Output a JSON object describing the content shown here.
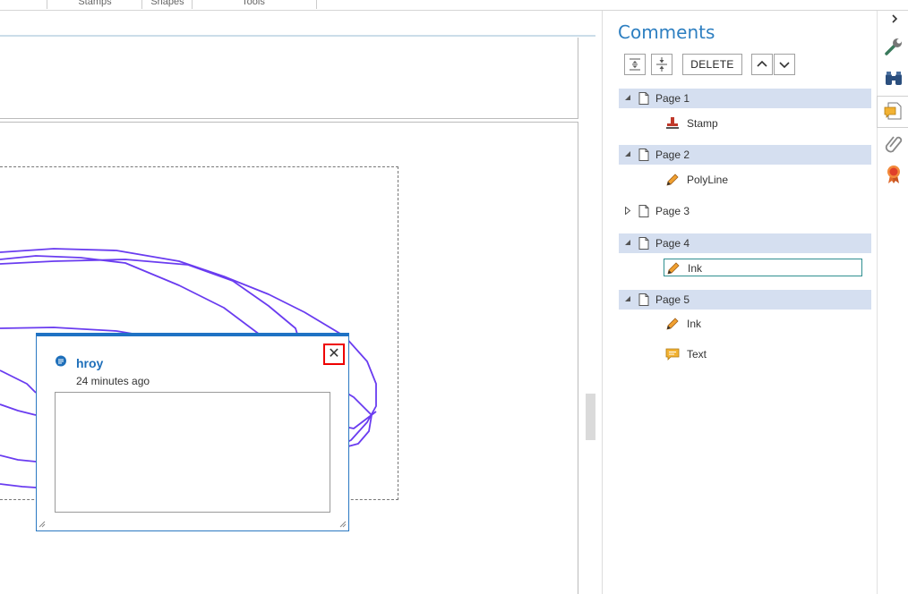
{
  "ribbon": {
    "groups": [
      "Stamps",
      "Shapes",
      "Tools"
    ]
  },
  "popup": {
    "author": "hroy",
    "time": "24 minutes ago",
    "close_glyph": "✕",
    "text": ""
  },
  "panel": {
    "title": "Comments",
    "delete_label": "DELETE",
    "pages": [
      {
        "label": "Page 1",
        "expanded": true,
        "items": [
          {
            "label": "Stamp",
            "icon": "stamp-icon"
          }
        ]
      },
      {
        "label": "Page 2",
        "expanded": true,
        "items": [
          {
            "label": "PolyLine",
            "icon": "pencil-icon"
          }
        ]
      },
      {
        "label": "Page 3",
        "expanded": false,
        "items": []
      },
      {
        "label": "Page 4",
        "expanded": true,
        "items": [
          {
            "label": "Ink",
            "icon": "pencil-icon",
            "selected": true
          }
        ]
      },
      {
        "label": "Page 5",
        "expanded": true,
        "items": [
          {
            "label": "Ink",
            "icon": "pencil-icon"
          },
          {
            "label": "Text",
            "icon": "text-note-icon"
          }
        ]
      }
    ]
  },
  "colors": {
    "accent": "#2d7fc1",
    "ink": "#6a3cf0",
    "row_highlight": "#d5dff0",
    "close_highlight": "#e00000"
  },
  "rail": {
    "icons": [
      "chevron-right-icon",
      "wrench-icon",
      "binoculars-icon",
      "comments-icon",
      "paperclip-icon",
      "badge-icon"
    ]
  }
}
